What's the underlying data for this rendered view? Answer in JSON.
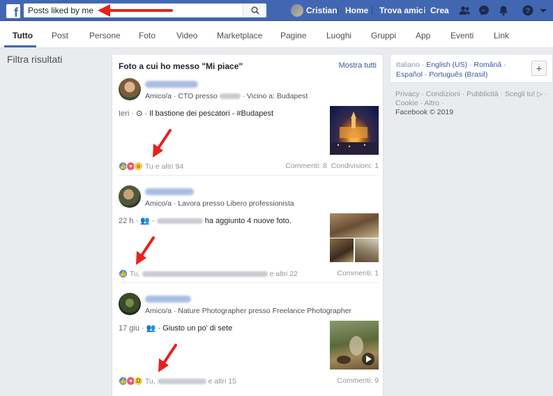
{
  "topbar": {
    "logo": "f",
    "search_value": "Posts liked by me",
    "user_name": "Cristian",
    "links": [
      "Home",
      "Trova amici",
      "Crea"
    ]
  },
  "tabs": [
    "Tutto",
    "Post",
    "Persone",
    "Foto",
    "Video",
    "Marketplace",
    "Pagine",
    "Luoghi",
    "Gruppi",
    "App",
    "Eventi",
    "Link"
  ],
  "sidebar": {
    "filter_title": "Filtra risultati"
  },
  "results": {
    "header": "Foto a cui ho messo \"Mi piace\"",
    "show_all": "Mostra tutti",
    "posts": [
      {
        "meta_prefix": "Amico/a · CTO presso",
        "meta_suffix": "· Vicino a: Budapest",
        "time": "Ieri ·",
        "text": "Il bastione dei pescatori - #Budapest",
        "reactions_text": "Tu e altri 94",
        "comments": "Commenti: 8",
        "shares": "Condivisioni: 1"
      },
      {
        "meta_prefix": "Amico/a · Lavora presso Libero professionista",
        "time": "22 h ·",
        "text": "ha aggiunto 4 nuove foto.",
        "reactions_prefix": "Tu,",
        "reactions_suffix": "e altri 22",
        "comments": "Commenti: 1"
      },
      {
        "meta_prefix": "Amico/a · Nature Photographer presso Freelance Photographer",
        "time": "17 giu ·",
        "text": "Giusto un po' di sete",
        "reactions_prefix": "Tu,",
        "reactions_suffix": "e altri 15",
        "comments": "Commenti: 9"
      }
    ]
  },
  "right": {
    "langs_current": "Italiano ·",
    "langs": [
      "English (US) ·",
      "Română ·",
      "Español ·",
      "Português (Brasil)"
    ],
    "plus": "+",
    "footer_links": "Privacy · Condizioni · Pubblicità · Scegli tu! ▷ · Cookie · Altro ·",
    "copyright": "Facebook © 2019"
  },
  "colors": {
    "brand": "#4267b2",
    "link": "#365899",
    "arrow": "#e8211b",
    "like": "#4a90e2",
    "love": "#f25268"
  }
}
